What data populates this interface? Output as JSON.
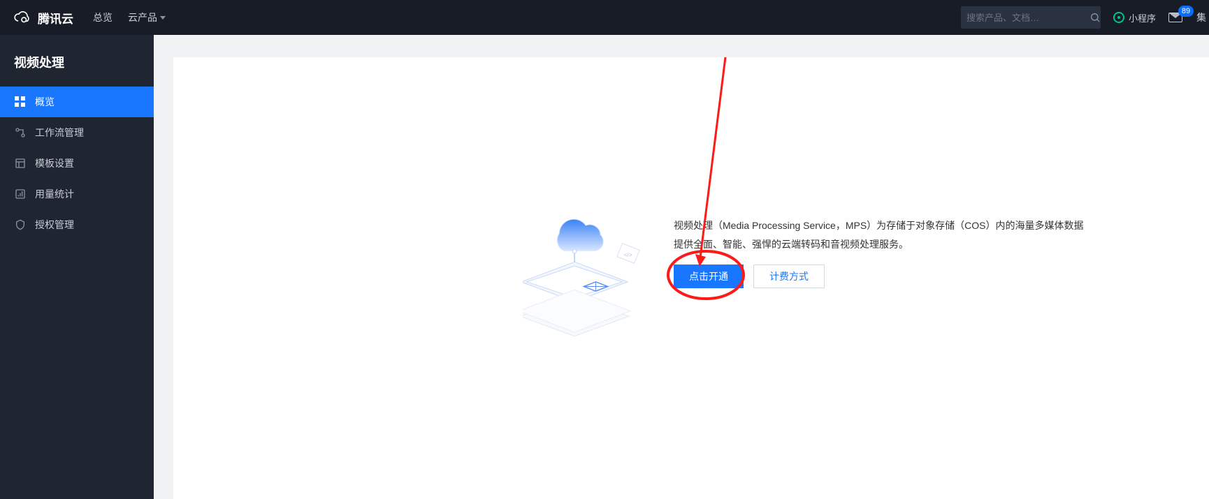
{
  "header": {
    "brand": "腾讯云",
    "nav_overview": "总览",
    "nav_products": "云产品",
    "search_placeholder": "搜索产品、文档…",
    "miniprogram_label": "小程序",
    "mail_badge": "89",
    "trail": "集"
  },
  "sidebar": {
    "title": "视频处理",
    "items": [
      {
        "icon": "grid-icon",
        "label": "概览",
        "active": true
      },
      {
        "icon": "workflow-icon",
        "label": "工作流管理",
        "active": false
      },
      {
        "icon": "template-icon",
        "label": "模板设置",
        "active": false
      },
      {
        "icon": "stats-icon",
        "label": "用量统计",
        "active": false
      },
      {
        "icon": "auth-icon",
        "label": "授权管理",
        "active": false
      }
    ]
  },
  "content": {
    "description": "视频处理（Media Processing Service，MPS）为存储于对象存储（COS）内的海量多媒体数据提供全面、智能、强悍的云端转码和音视频处理服务。",
    "primary_btn": "点击开通",
    "secondary_btn": "计费方式"
  },
  "annotation": {
    "kind": "red-circle-arrow",
    "target": "primary button"
  }
}
